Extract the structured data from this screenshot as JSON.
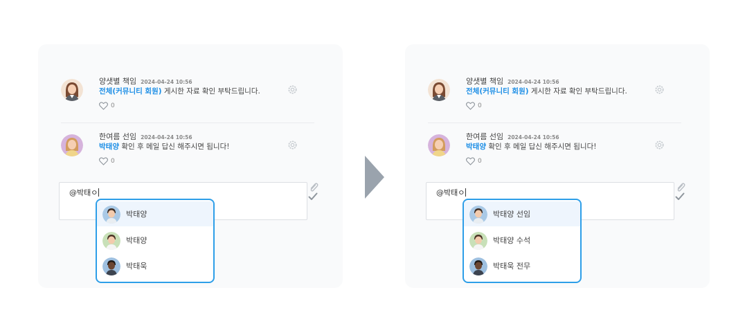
{
  "left_panel": {
    "comments": [
      {
        "author": "양샛별  책임",
        "date": "2024-04-24 10:56",
        "mention": "전체(커뮤니티 회원)",
        "text": " 게시한 자료 확인 부탁드립니다.",
        "likes": "0"
      },
      {
        "author": "한여름  선임",
        "date": "2024-04-24 10:56",
        "mention": "박태양",
        "text": " 확인 후 메일 답신 해주시면 됩니다!",
        "likes": "0"
      }
    ],
    "input_value": "@박태ㅇ",
    "suggestions": [
      {
        "name": "박태양"
      },
      {
        "name": "박태양"
      },
      {
        "name": "박태욱"
      }
    ]
  },
  "right_panel": {
    "comments": [
      {
        "author": "양샛별  책임",
        "date": "2024-04-24 10:56",
        "mention": "전체(커뮤니티 회원)",
        "text": " 게시한 자료 확인 부탁드립니다.",
        "likes": "0"
      },
      {
        "author": "한여름  선임",
        "date": "2024-04-24 10:56",
        "mention": "박태양",
        "text": " 확인 후 메일 답신 해주시면 됩니다!",
        "likes": "0"
      }
    ],
    "input_value": "@박태ㅇ",
    "suggestions": [
      {
        "name": "박태양 선임"
      },
      {
        "name": "박태양 수석"
      },
      {
        "name": "박태욱 전무"
      }
    ]
  },
  "colors": {
    "mention": "#1e8fe6",
    "dropdown_border": "#2d9ee8",
    "active_row": "#eef5fd",
    "arrow": "#9aa3ad"
  },
  "icons": [
    "heart-icon",
    "gear-icon",
    "paperclip-icon",
    "check-icon",
    "arrow-right-icon"
  ]
}
